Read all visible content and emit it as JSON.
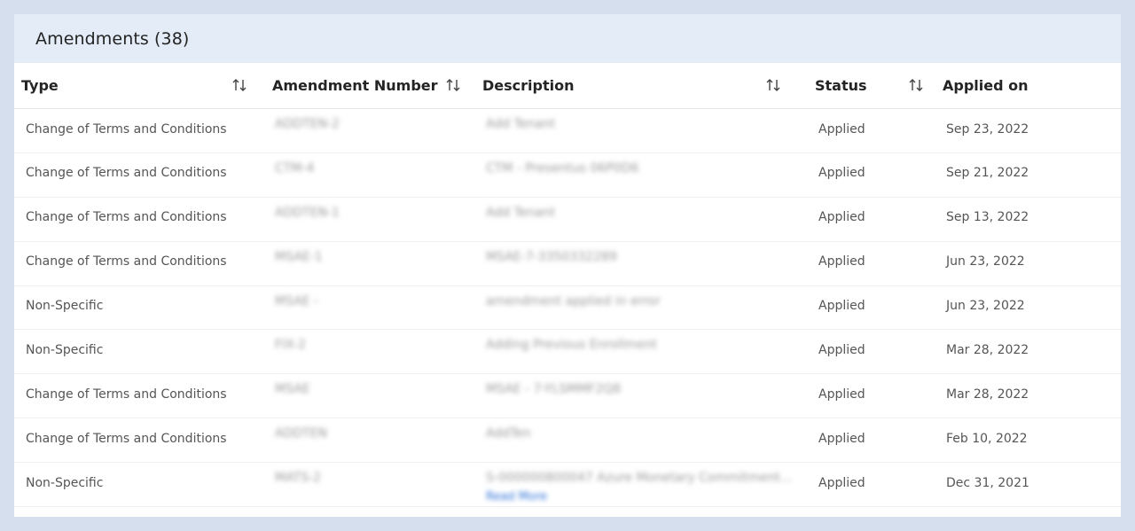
{
  "panel": {
    "title": "Amendments (38)"
  },
  "columns": {
    "type": "Type",
    "amendment_number": "Amendment Number",
    "description": "Description",
    "status": "Status",
    "applied_on": "Applied on"
  },
  "rows": [
    {
      "type": "Change of Terms and Conditions",
      "number": "ADDTEN-2",
      "description": "Add Tenant",
      "status": "Applied",
      "date": "Sep 23, 2022"
    },
    {
      "type": "Change of Terms and Conditions",
      "number": "CTM-4",
      "description": "CTM - Presentus 06P0D6",
      "status": "Applied",
      "date": "Sep 21, 2022"
    },
    {
      "type": "Change of Terms and Conditions",
      "number": "ADDTEN-1",
      "description": "Add Tenant",
      "status": "Applied",
      "date": "Sep 13, 2022"
    },
    {
      "type": "Change of Terms and Conditions",
      "number": "MSAE-1",
      "description": "MSAE-7-3350332289",
      "status": "Applied",
      "date": "Jun 23, 2022"
    },
    {
      "type": "Non-Specific",
      "number": "MSAE -",
      "description": "amendment applied in error",
      "status": "Applied",
      "date": "Jun 23, 2022"
    },
    {
      "type": "Non-Specific",
      "number": "FIX-2",
      "description": "Adding Previous Enrollment",
      "status": "Applied",
      "date": "Mar 28, 2022"
    },
    {
      "type": "Change of Terms and Conditions",
      "number": "MSAE",
      "description": "MSAE - 7-YLSMMF2Q8",
      "status": "Applied",
      "date": "Mar 28, 2022"
    },
    {
      "type": "Change of Terms and Conditions",
      "number": "ADDTEN",
      "description": "AddTen",
      "status": "Applied",
      "date": "Feb 10, 2022"
    },
    {
      "type": "Non-Specific",
      "number": "MATS-2",
      "description": "S-000000800047 Azure Monetary Commitment...",
      "read_more": "Read More",
      "status": "Applied",
      "date": "Dec 31, 2021"
    }
  ],
  "icons": {
    "sort": "sort-arrows-icon"
  },
  "colors": {
    "page_bg": "#d6dfee",
    "header_bg": "#e3ecf7",
    "link": "#2a6fd6"
  }
}
